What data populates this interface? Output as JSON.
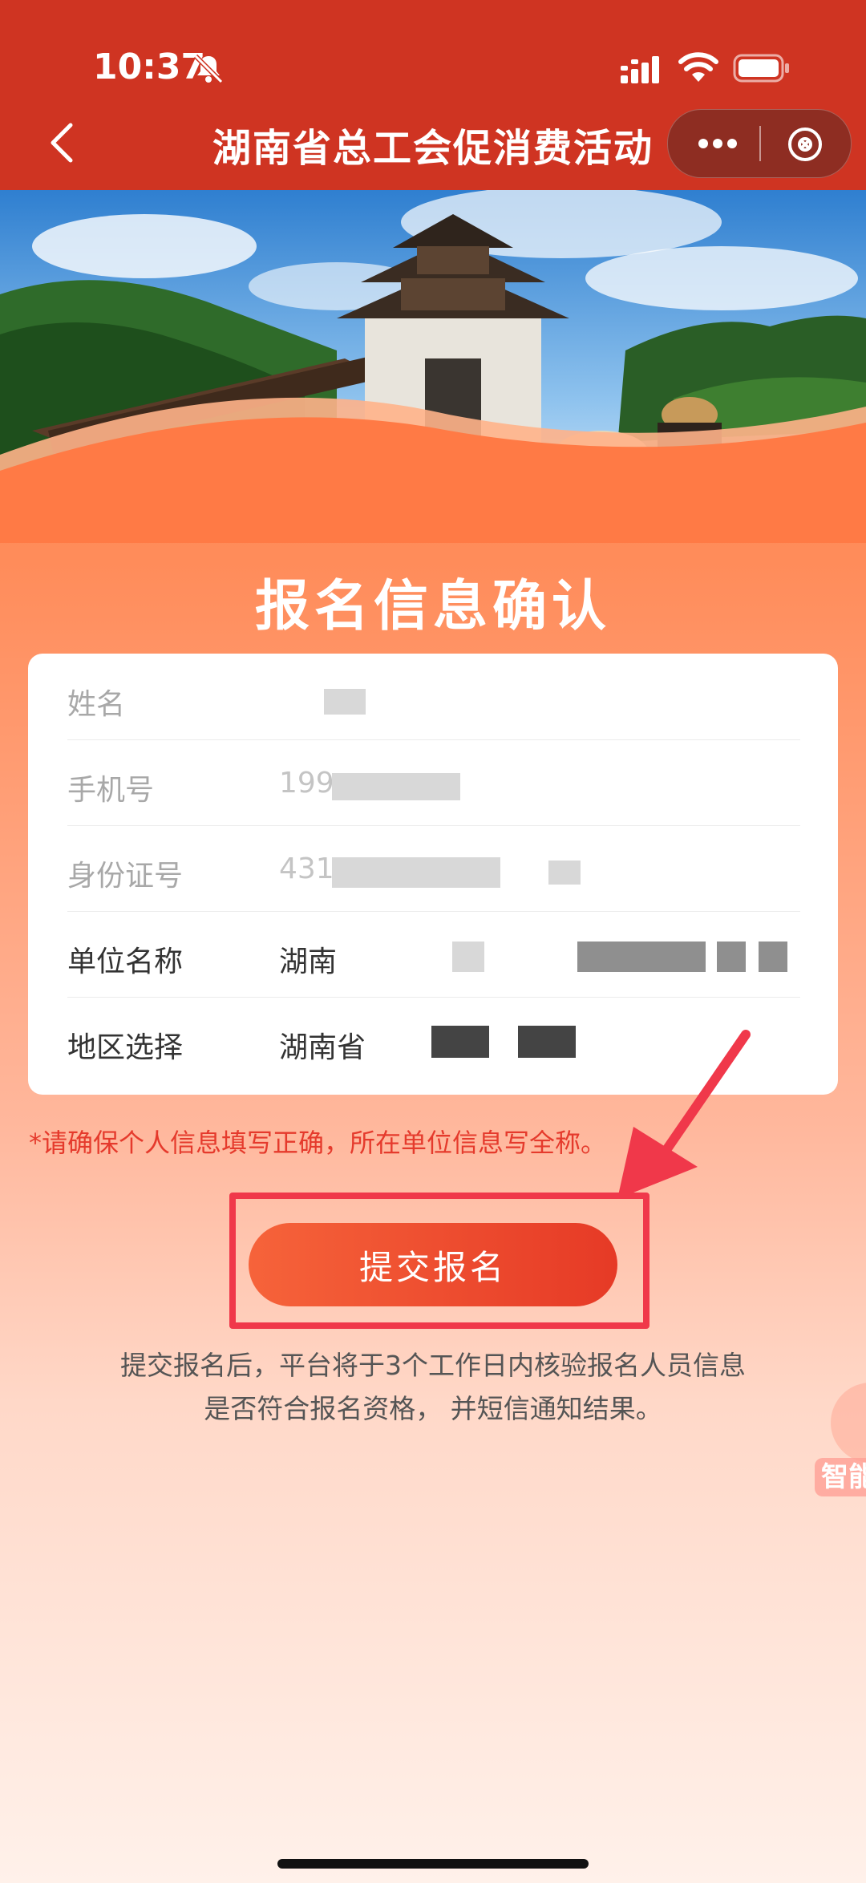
{
  "status_bar": {
    "time": "10:37"
  },
  "nav": {
    "title": "湖南省总工会促消费活动"
  },
  "page": {
    "heading": "报名信息确认"
  },
  "form": {
    "rows": [
      {
        "label": "姓名",
        "value": ""
      },
      {
        "label": "手机号",
        "value": "199"
      },
      {
        "label": "身份证号",
        "value": "431"
      },
      {
        "label": "单位名称",
        "value": "湖南"
      },
      {
        "label": "地区选择",
        "value": "湖南省"
      }
    ]
  },
  "notice": "*请确保个人信息填写正确，所在单位信息写全称。",
  "submit": {
    "label": "提交报名"
  },
  "description": {
    "line1": "提交报名后，平台将于3个工作日内核验报名人员信息",
    "line2": "是否符合报名资格， 并短信通知结果。"
  },
  "assistant": {
    "label": "智能"
  },
  "colors": {
    "header": "#cf3422",
    "accent": "#e63a26",
    "notice": "#e53a2c",
    "highlight": "#f0384a"
  }
}
